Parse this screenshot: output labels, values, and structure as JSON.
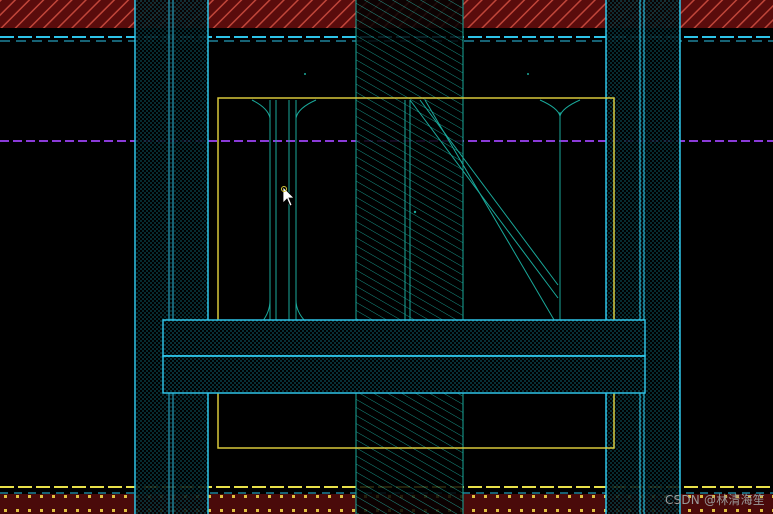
{
  "watermark": "CSDN @林清海笙",
  "colors": {
    "background": "#000000",
    "metal_hatch": "#c0463a",
    "metal_band": "#7a1010",
    "cyan_layer": "#2ec4e8",
    "teal_poly": "#1aa89a",
    "yellow_outline": "#d8c83a",
    "purple_line": "#8a3ad8",
    "yellow_rail": "#e8e04a"
  },
  "icons": {
    "cursor": "pointer-arrow-icon"
  }
}
